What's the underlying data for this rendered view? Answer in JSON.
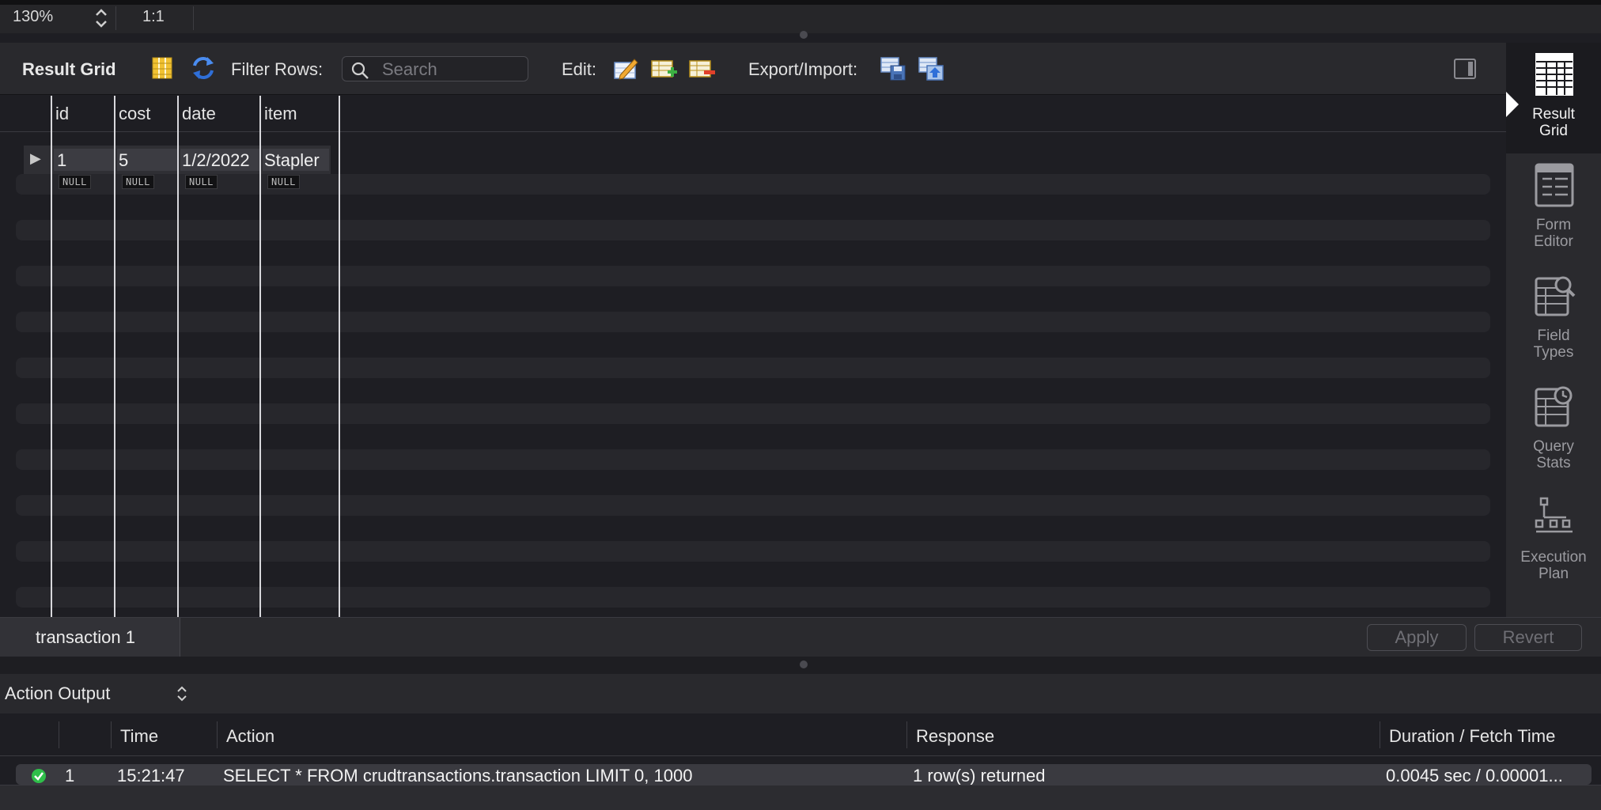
{
  "zoom": {
    "value": "130%",
    "ratio": "1:1"
  },
  "toolbar": {
    "title": "Result Grid",
    "filter_label": "Filter Rows:",
    "search_placeholder": "Search",
    "edit_label": "Edit:",
    "export_label": "Export/Import:"
  },
  "grid": {
    "columns": [
      "id",
      "cost",
      "date",
      "item"
    ],
    "rows": [
      {
        "id": "1",
        "cost": "5",
        "date": "1/2/2022",
        "item": "Stapler"
      }
    ],
    "null_label": "NULL"
  },
  "sidetabs": [
    {
      "label1": "Result",
      "label2": "Grid",
      "icon": "result-grid-icon",
      "active": true
    },
    {
      "label1": "Form",
      "label2": "Editor",
      "icon": "form-editor-icon",
      "active": false
    },
    {
      "label1": "Field",
      "label2": "Types",
      "icon": "field-types-icon",
      "active": false
    },
    {
      "label1": "Query",
      "label2": "Stats",
      "icon": "query-stats-icon",
      "active": false
    },
    {
      "label1": "Execution",
      "label2": "Plan",
      "icon": "execution-plan-icon",
      "active": false
    }
  ],
  "tabbar": {
    "tab_label": "transaction 1",
    "apply_label": "Apply",
    "revert_label": "Revert"
  },
  "output": {
    "selector_label": "Action Output",
    "columns": {
      "time": "Time",
      "action": "Action",
      "response": "Response",
      "duration": "Duration / Fetch Time"
    },
    "rows": [
      {
        "num": "1",
        "time": "15:21:47",
        "action": "SELECT * FROM crudtransactions.transaction LIMIT 0, 1000",
        "response": "1 row(s) returned",
        "duration": "0.0045 sec / 0.00001..."
      }
    ]
  },
  "colors": {
    "accent_blue": "#4a8cf0",
    "ok_green": "#2fbf4a",
    "panel_bg": "#1e1e23"
  }
}
